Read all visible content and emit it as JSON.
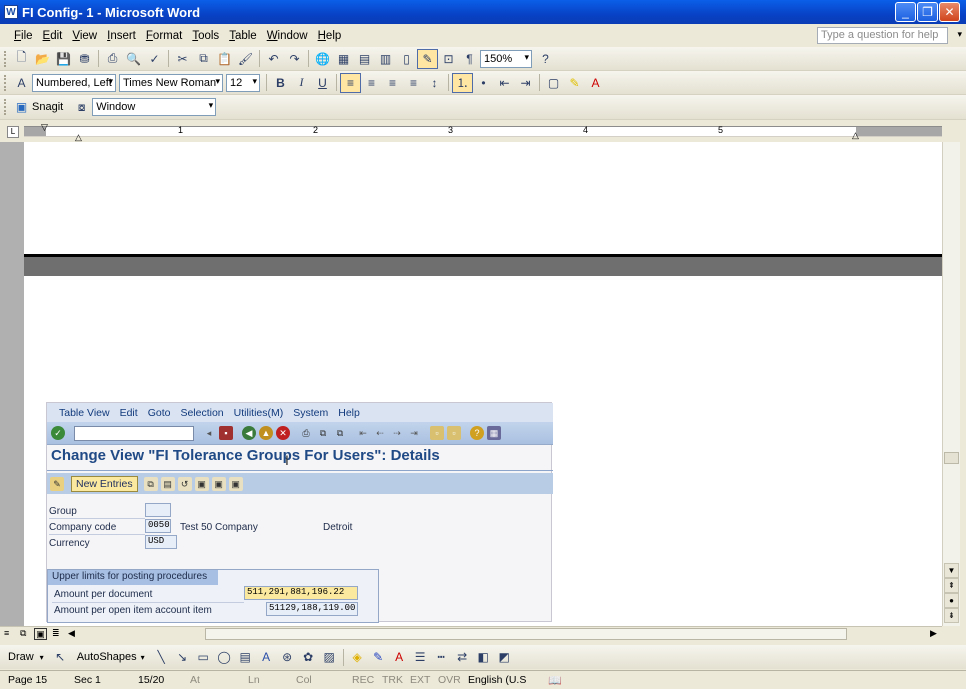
{
  "window": {
    "title": "FI Config- 1 - Microsoft Word",
    "app_icon": "W"
  },
  "menu": [
    "File",
    "Edit",
    "View",
    "Insert",
    "Format",
    "Tools",
    "Table",
    "Window",
    "Help"
  ],
  "ask_placeholder": "Type a question for help",
  "standard_toolbar": {
    "zoom": "150%"
  },
  "formatting_toolbar": {
    "style": "Numbered, Left",
    "font": "Times New Roman",
    "size": "12",
    "bold": "B",
    "italic": "I",
    "underline": "U"
  },
  "snagit_toolbar": {
    "snagit_label": "Snagit",
    "capture_mode": "Window"
  },
  "ruler_numbers": [
    "1",
    "2",
    "3",
    "4",
    "5"
  ],
  "sap": {
    "menu": [
      "Table View",
      "Edit",
      "Goto",
      "Selection",
      "Utilities(M)",
      "System",
      "Help"
    ],
    "title": "Change View \"FI Tolerance Groups For Users\": Details",
    "new_entries_label": "New Entries",
    "fields": {
      "group_label": "Group",
      "group_value": "",
      "company_code_label": "Company code",
      "company_code_value": "0050",
      "company_name": "Test 50 Company",
      "company_city": "Detroit",
      "currency_label": "Currency",
      "currency_value": "USD"
    },
    "group_box_title": "Upper limits for posting procedures",
    "limits": [
      {
        "label": "Amount per document",
        "value": "511,291,881,196.22"
      },
      {
        "label": "Amount per open item account item",
        "value": "51129,188,119.00"
      }
    ]
  },
  "draw_toolbar": {
    "draw_label": "Draw",
    "autoshapes_label": "AutoShapes"
  },
  "status_bar": {
    "page": "Page 15",
    "sec": "Sec 1",
    "of": "15/20",
    "at": "At",
    "ln": "Ln",
    "col": "Col",
    "rec": "REC",
    "trk": "TRK",
    "ext": "EXT",
    "ovr": "OVR",
    "language": "English (U.S"
  }
}
